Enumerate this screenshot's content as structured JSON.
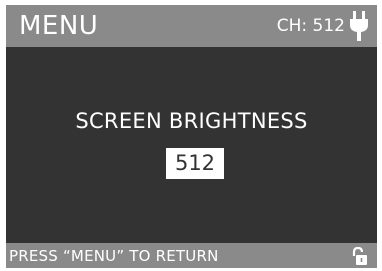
{
  "header": {
    "title": "MENU",
    "channel_label": "CH: 512",
    "power_icon": "plug-icon"
  },
  "main": {
    "setting_label": "SCREEN BRIGHTNESS",
    "setting_value": "512"
  },
  "footer": {
    "hint": "PRESS “MENU” TO RETURN",
    "lock_icon": "unlocked-padlock-icon"
  },
  "colors": {
    "bar": "#8a8a8a",
    "background": "#333333",
    "text": "#ffffff",
    "value_box": "#ffffff"
  }
}
